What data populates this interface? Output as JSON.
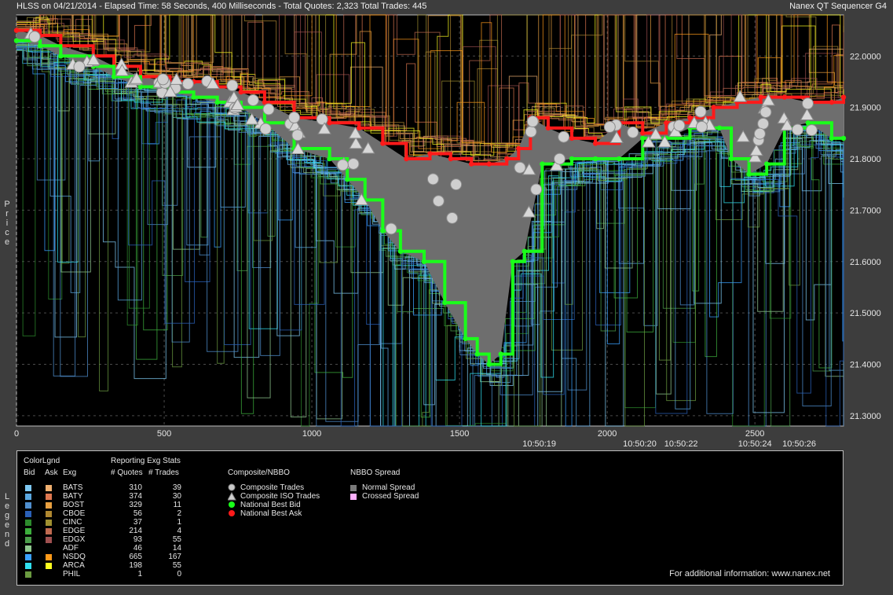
{
  "header": {
    "left": "HLSS on 04/21/2014  -  Elapsed Time: 58 Seconds, 400 Milliseconds  -  Total Quotes: 2,323  Total Trades: 445",
    "right": "Nanex QT Sequencer G4"
  },
  "side_labels": {
    "price": "Price",
    "legend": "Legend"
  },
  "chart_data": {
    "type": "line",
    "ylabel": "Price",
    "ylim": [
      21.28,
      22.08
    ],
    "xlim": [
      0,
      2800
    ],
    "y_ticks": [
      "22.0000",
      "21.9000",
      "21.8000",
      "21.7000",
      "21.6000",
      "21.5000",
      "21.4000",
      "21.3000"
    ],
    "x_ticks": [
      "0",
      "500",
      "1000",
      "1500",
      "2000",
      "2500"
    ],
    "time_ticks": [
      {
        "x": 1770,
        "label": "10:50:19"
      },
      {
        "x": 2110,
        "label": "10:50:20"
      },
      {
        "x": 2250,
        "label": "10:50:22"
      },
      {
        "x": 2500,
        "label": "10:50:24"
      },
      {
        "x": 2650,
        "label": "10:50:26"
      }
    ],
    "grid": true,
    "series": [
      {
        "name": "National Best Ask",
        "color": "#ff1a1a",
        "x": [
          0,
          80,
          150,
          260,
          330,
          420,
          520,
          600,
          680,
          760,
          840,
          940,
          1060,
          1160,
          1240,
          1320,
          1400,
          1470,
          1540,
          1600,
          1660,
          1700,
          1740,
          1800,
          1880,
          1960,
          2040,
          2120,
          2200,
          2280,
          2360,
          2440,
          2520,
          2600,
          2680,
          2760,
          2800
        ],
        "y": [
          22.05,
          22.04,
          22.02,
          22.0,
          21.98,
          21.96,
          21.95,
          21.95,
          21.94,
          21.93,
          21.91,
          21.88,
          21.87,
          21.86,
          21.83,
          21.8,
          21.81,
          21.8,
          21.79,
          21.79,
          21.8,
          21.82,
          21.88,
          21.86,
          21.84,
          21.83,
          21.87,
          21.85,
          21.87,
          21.88,
          21.9,
          21.91,
          21.92,
          21.92,
          21.91,
          21.91,
          21.92
        ]
      },
      {
        "name": "National Best Bid",
        "color": "#1aff1a",
        "x": [
          0,
          80,
          150,
          260,
          330,
          420,
          520,
          600,
          680,
          760,
          840,
          940,
          1060,
          1120,
          1180,
          1240,
          1300,
          1380,
          1450,
          1520,
          1560,
          1600,
          1640,
          1680,
          1720,
          1780,
          1880,
          1960,
          2040,
          2120,
          2200,
          2280,
          2380,
          2420,
          2480,
          2540,
          2600,
          2680,
          2760,
          2800
        ],
        "y": [
          22.03,
          22.02,
          22.0,
          21.98,
          21.96,
          21.94,
          21.93,
          21.92,
          21.91,
          21.9,
          21.87,
          21.82,
          21.8,
          21.76,
          21.72,
          21.66,
          21.62,
          21.6,
          21.52,
          21.45,
          21.42,
          21.4,
          21.42,
          21.6,
          21.62,
          21.79,
          21.8,
          21.8,
          21.8,
          21.84,
          21.84,
          21.86,
          21.86,
          21.8,
          21.77,
          21.79,
          21.86,
          21.87,
          21.84,
          21.84
        ]
      }
    ]
  },
  "legend": {
    "color_legend_title": "ColorLgnd",
    "stats_title": "Reporting Exg Stats",
    "col_bid": "Bid",
    "col_ask": "Ask",
    "col_exg": "Exg",
    "col_quotes": "# Quotes",
    "col_trades": "# Trades",
    "exchanges": [
      {
        "exg": "BATS",
        "quotes": "310",
        "trades": "39",
        "bid_color": "#7ec8f2",
        "ask_color": "#f0b070"
      },
      {
        "exg": "BATY",
        "quotes": "374",
        "trades": "30",
        "bid_color": "#5aa7e0",
        "ask_color": "#e07850"
      },
      {
        "exg": "BOST",
        "quotes": "329",
        "trades": "11",
        "bid_color": "#4f8fcf",
        "ask_color": "#e8a040"
      },
      {
        "exg": "CBOE",
        "quotes": "56",
        "trades": "2",
        "bid_color": "#2a60b8",
        "ask_color": "#b08830"
      },
      {
        "exg": "CINC",
        "quotes": "37",
        "trades": "1",
        "bid_color": "#2c8a2c",
        "ask_color": "#a09030"
      },
      {
        "exg": "EDGE",
        "quotes": "214",
        "trades": "4",
        "bid_color": "#3cae3c",
        "ask_color": "#c06a50"
      },
      {
        "exg": "EDGX",
        "quotes": "93",
        "trades": "55",
        "bid_color": "#4a9c4a",
        "ask_color": "#a05050"
      },
      {
        "exg": "ADF",
        "quotes": "46",
        "trades": "14",
        "bid_color": "#90c890",
        "ask_color": ""
      },
      {
        "exg": "NSDQ",
        "quotes": "665",
        "trades": "167",
        "bid_color": "#3aa0ff",
        "ask_color": "#ff9a1a"
      },
      {
        "exg": "ARCA",
        "quotes": "198",
        "trades": "55",
        "bid_color": "#30e0f0",
        "ask_color": "#ffff20"
      },
      {
        "exg": "PHIL",
        "quotes": "1",
        "trades": "0",
        "bid_color": "#6a9a40",
        "ask_color": ""
      }
    ],
    "composite_title": "Composite/NBBO",
    "composite_items": [
      "Composite Trades",
      "Composite ISO Trades",
      "National Best Bid",
      "National Best Ask"
    ],
    "spread_title": "NBBO Spread",
    "spread_items": [
      {
        "label": "Normal Spread",
        "color": "#7a7a7a"
      },
      {
        "label": "Crossed Spread",
        "color": "#ffb0ff"
      }
    ],
    "footer": "For additional information: www.nanex.net"
  }
}
